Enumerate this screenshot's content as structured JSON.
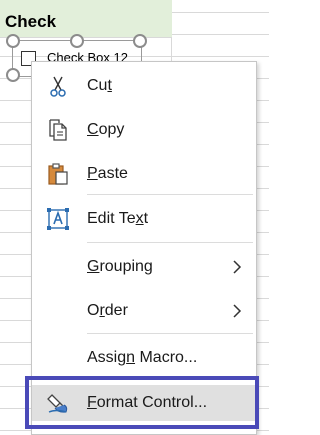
{
  "sheet": {
    "header_text": "Check",
    "checkbox_label": "Check Box 12"
  },
  "menu": {
    "items": [
      {
        "pre": "Cu",
        "ul": "t",
        "post": "",
        "icon": "scissors-icon"
      },
      {
        "pre": "",
        "ul": "C",
        "post": "opy",
        "icon": "copy-icon"
      },
      {
        "pre": "",
        "ul": "P",
        "post": "aste",
        "icon": "paste-icon"
      },
      {
        "pre": "Edit Te",
        "ul": "x",
        "post": "t",
        "icon": "edit-text-icon"
      },
      {
        "pre": "",
        "ul": "G",
        "post": "rouping",
        "icon": "chevron-right-icon"
      },
      {
        "pre": "O",
        "ul": "r",
        "post": "der",
        "icon": "chevron-right-icon"
      },
      {
        "pre": "Assig",
        "ul": "n",
        "post": " Macro...",
        "icon": ""
      },
      {
        "pre": "",
        "ul": "F",
        "post": "ormat Control...",
        "icon": "format-control-icon"
      }
    ]
  },
  "colors": {
    "header_fill": "#e2efda",
    "hover_fill": "#e0e0e0",
    "focus_border": "#4a4ab8"
  }
}
